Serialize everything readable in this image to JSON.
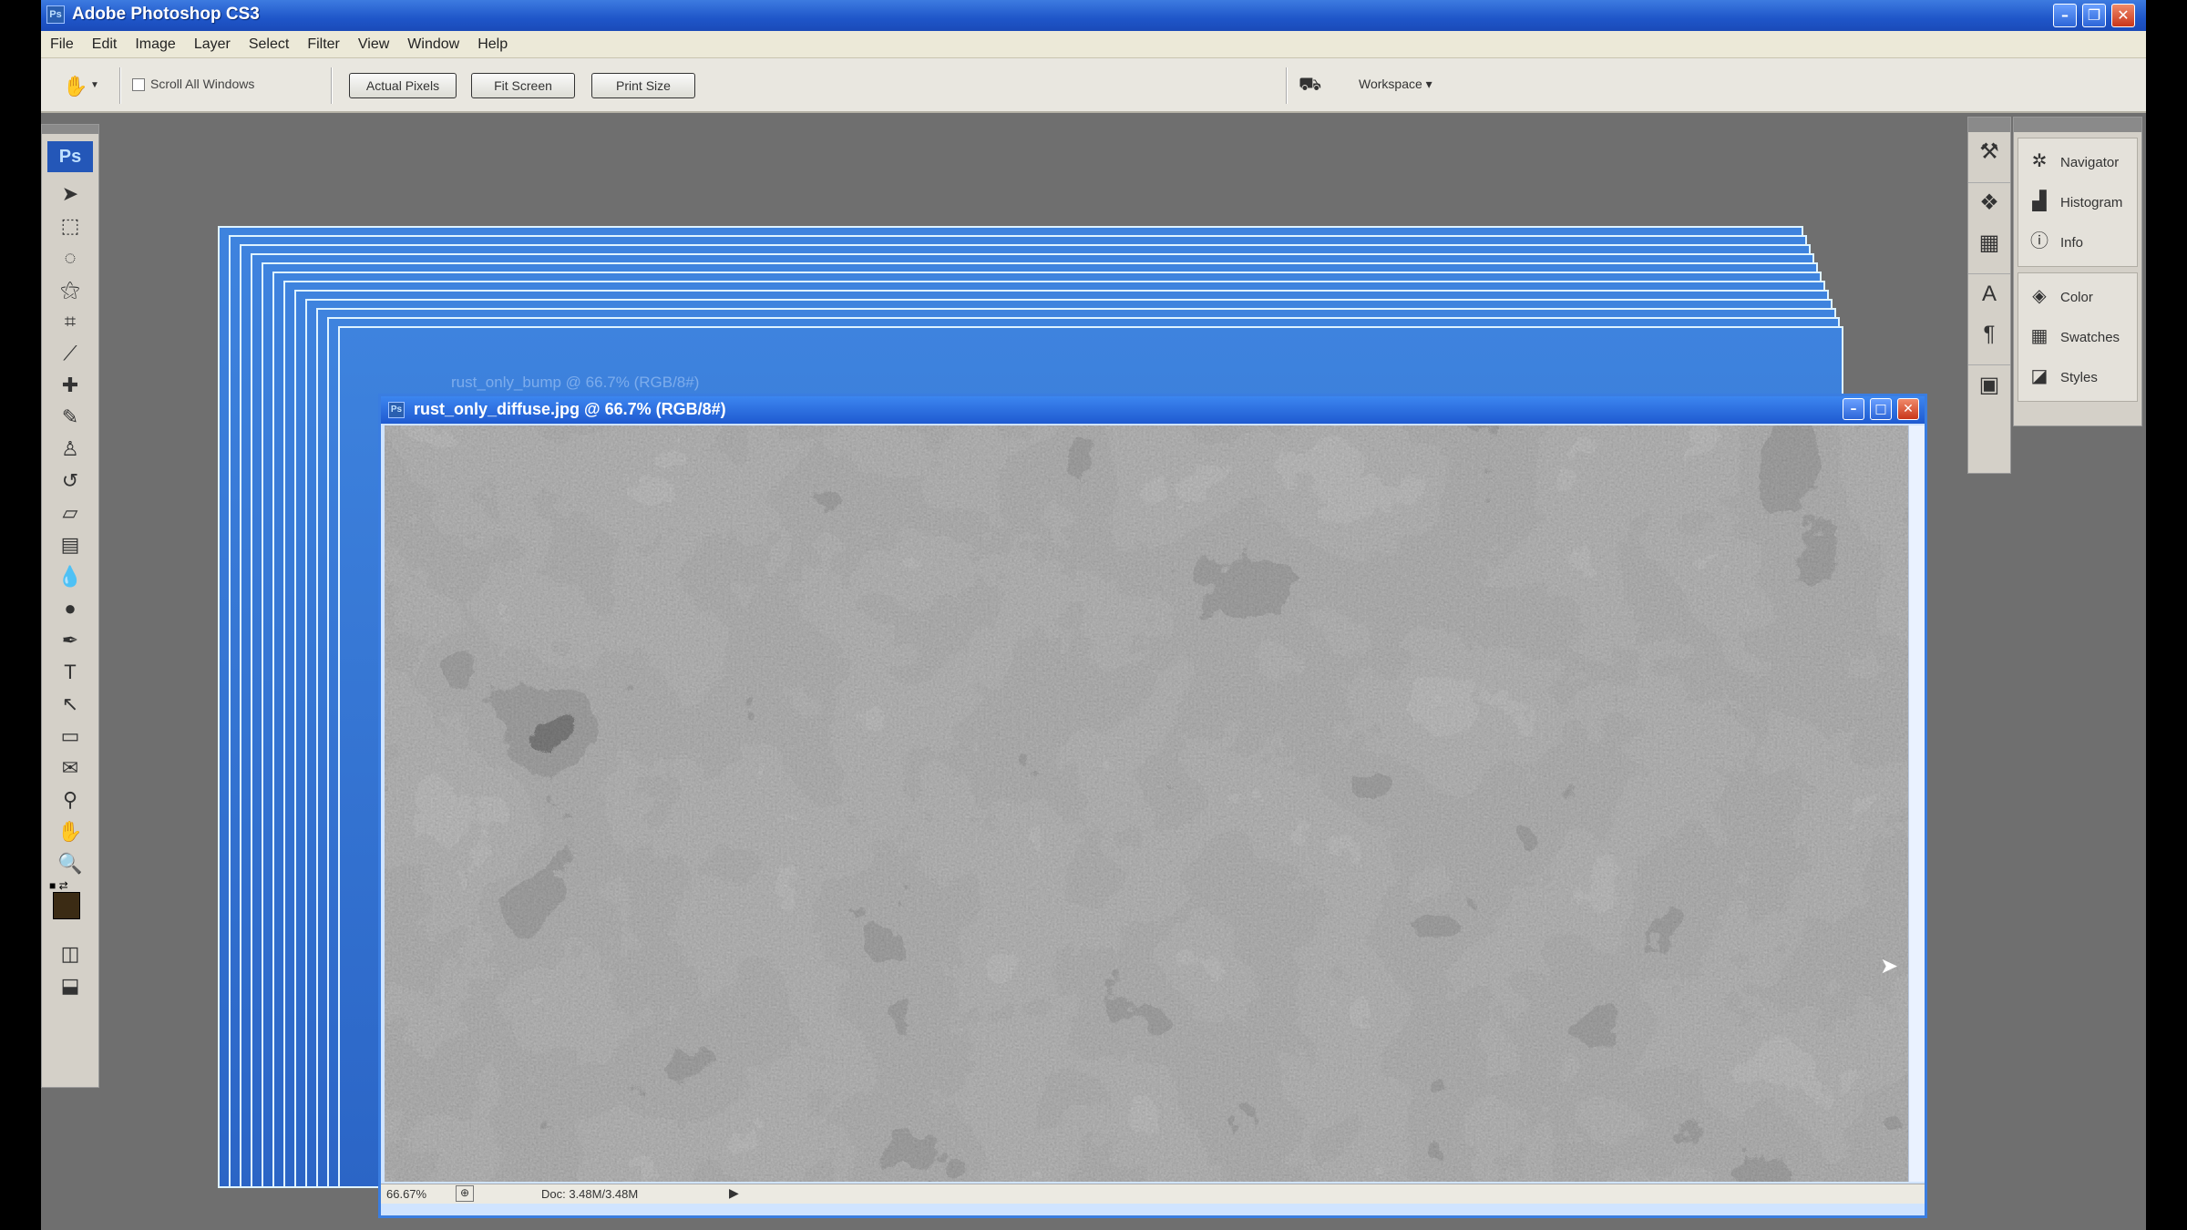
{
  "window": {
    "title": "Adobe Photoshop CS3",
    "ps_logo": "Ps"
  },
  "menu": [
    "File",
    "Edit",
    "Image",
    "Layer",
    "Select",
    "Filter",
    "View",
    "Window",
    "Help"
  ],
  "options": {
    "scroll_all_label": "Scroll All Windows",
    "scroll_all_checked": false,
    "actual_pixels": "Actual Pixels",
    "fit_screen": "Fit Screen",
    "print_size": "Print Size",
    "workspace": "Workspace ▾"
  },
  "document": {
    "title": "rust_only_diffuse.jpg @ 66.7% (RGB/8#)",
    "behind_title": "rust_only_bump @ 66.7% (RGB/8#)",
    "zoom": "66.67%",
    "doc_info": "Doc: 3.48M/3.48M"
  },
  "panels": {
    "group1": [
      {
        "label": "Navigator",
        "icon": "navigator-icon"
      },
      {
        "label": "Histogram",
        "icon": "histogram-icon"
      },
      {
        "label": "Info",
        "icon": "info-icon"
      }
    ],
    "group2": [
      {
        "label": "Color",
        "icon": "color-icon"
      },
      {
        "label": "Swatches",
        "icon": "swatches-icon"
      },
      {
        "label": "Styles",
        "icon": "styles-icon"
      }
    ]
  },
  "colors": {
    "foreground": "#3b2b14",
    "titlebar": "#1f56c9",
    "workspace_bg": "#6f6f6f"
  }
}
